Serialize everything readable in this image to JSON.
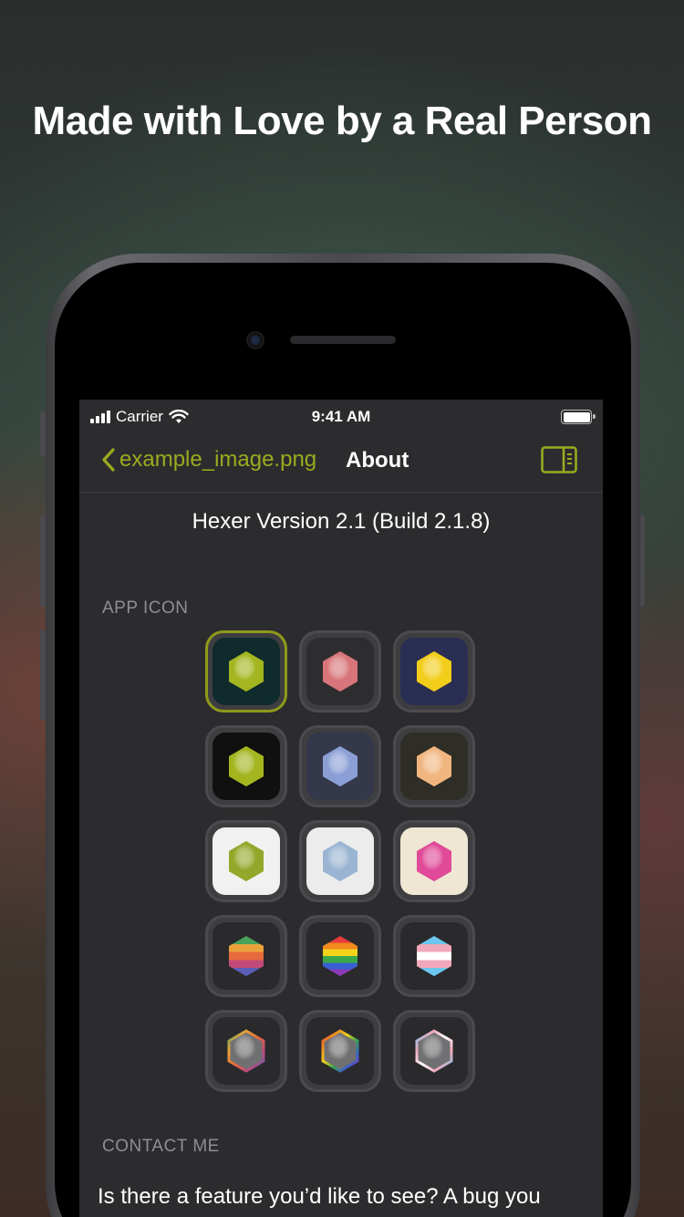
{
  "headline": "Made with Love by a Real Person",
  "status_bar": {
    "carrier": "Carrier",
    "time": "9:41 AM"
  },
  "nav": {
    "back_label": "example_image.png",
    "title": "About",
    "sidebar_toggle_icon": "sidebar-toggle-icon"
  },
  "version_text": "Hexer Version 2.1 (Build 2.1.8)",
  "app_icon_section": {
    "label": "APP ICON",
    "icons": [
      {
        "name": "green-on-teal",
        "bg": "#0f2b2c",
        "hex": "#a3b51f",
        "selected": true
      },
      {
        "name": "red-on-dark",
        "bg": "#2d2d2f",
        "hex": "#d8757a"
      },
      {
        "name": "yellow-on-navy",
        "bg": "#2a2e52",
        "hex": "#f2cd1a"
      },
      {
        "name": "green-on-black",
        "bg": "#101010",
        "hex": "#a3b51f"
      },
      {
        "name": "blue-on-slate",
        "bg": "#34384a",
        "hex": "#8b9fd6"
      },
      {
        "name": "peach-on-olive",
        "bg": "#2e2d26",
        "hex": "#f1b680"
      },
      {
        "name": "green-on-white",
        "bg": "#f1f1f1",
        "hex": "#93a82a"
      },
      {
        "name": "blue-on-white",
        "bg": "#ececec",
        "hex": "#9ab5d2"
      },
      {
        "name": "pink-on-cream",
        "bg": "#efe7d4",
        "hex": "#e04a98"
      },
      {
        "name": "sunset-stripes",
        "bg": "#2a2a2c",
        "hex": "stripes-sunset"
      },
      {
        "name": "rainbow-stripes",
        "bg": "#2a2a2c",
        "hex": "stripes-rainbow"
      },
      {
        "name": "trans-stripes",
        "bg": "#2a2a2c",
        "hex": "stripes-trans"
      },
      {
        "name": "grey-sunset-outline",
        "bg": "#2a2a2c",
        "hex": "#707072",
        "outline": "sunset"
      },
      {
        "name": "grey-rainbow-outline",
        "bg": "#2a2a2c",
        "hex": "#707072",
        "outline": "rainbow"
      },
      {
        "name": "grey-trans-outline",
        "bg": "#2a2a2c",
        "hex": "#707072",
        "outline": "trans"
      }
    ]
  },
  "contact_section": {
    "label": "CONTACT ME",
    "text": "Is there a feature you’d like to see? A bug you"
  },
  "colors": {
    "accent": "#9bab1e",
    "screen_bg": "#2c2c2e",
    "label_grey": "#8e8e93"
  }
}
